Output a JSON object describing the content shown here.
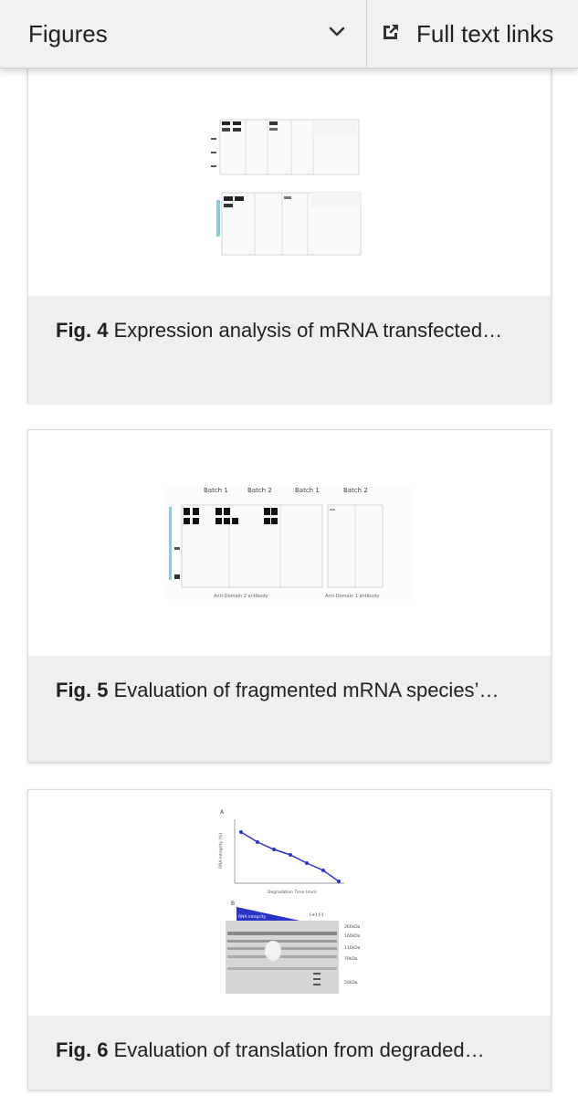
{
  "header": {
    "figures_label": "Figures",
    "fulltext_label": "Full text links",
    "icons": {
      "dropdown": "chevron-down-icon",
      "external": "external-link-icon"
    }
  },
  "figures": [
    {
      "fig_label": "Fig. 4",
      "caption": "Expression analysis of mRNA transfected…"
    },
    {
      "fig_label": "Fig. 5",
      "caption": "Evaluation of fragmented mRNA species’…",
      "image_text": {
        "batch_headers": [
          "Batch 1",
          "Batch 2",
          "Batch 1",
          "Batch 2"
        ],
        "footer_labels": [
          "Anti-Domain 2 antibody",
          "Anti-Domain 1 antibody"
        ]
      }
    },
    {
      "fig_label": "Fig. 6",
      "caption": "Evaluation of translation from degraded…",
      "image_text": {
        "panel_a": "A",
        "panel_b": "B",
        "y_axis": "RNA Integrity (%)",
        "x_axis": "Degradation Time (min)",
        "gradient_label": "RNA integrity",
        "controls": "(+)  (-)",
        "ladder": [
          "260kDa",
          "160kDa",
          "110kDa",
          "70kDa",
          "50kDa"
        ]
      }
    }
  ],
  "colors": {
    "accent_blue": "#2a34c8",
    "caption_bg": "#efefef",
    "header_bg": "#f1f1f1"
  }
}
